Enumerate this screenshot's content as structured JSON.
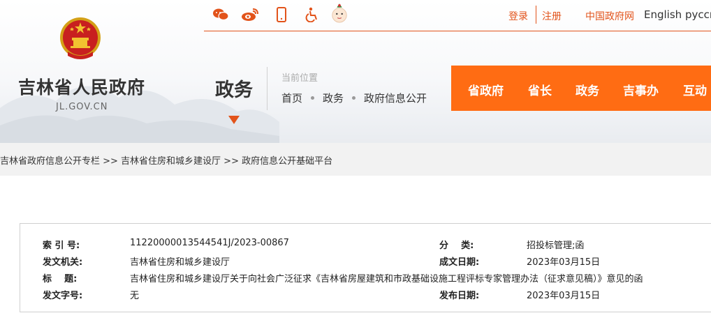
{
  "topbar": {
    "icons": [
      "wechat-icon",
      "weibo-icon",
      "mobile-icon",
      "accessibility-icon",
      "mascot-icon"
    ],
    "login": "登录",
    "register": "注册",
    "gov_link": "中国政府网",
    "english": "English",
    "russian": "русск"
  },
  "site": {
    "name": "吉林省人民政府",
    "domain": "JL.GOV.CN"
  },
  "section": {
    "title": "政务"
  },
  "location": {
    "label": "当前位置",
    "crumbs": [
      "首页",
      "政务",
      "政府信息公开"
    ]
  },
  "nav": {
    "items": [
      "省政府",
      "省长",
      "政务",
      "吉事办",
      "互动"
    ]
  },
  "path": {
    "text": "吉林省政府信息公开专栏 >> 吉林省住房和城乡建设厅 >> 政府信息公开基础平台"
  },
  "info": {
    "index_label": "索 引 号:",
    "index_value": "11220000013544541J/2023-00867",
    "category_label": "分    类:",
    "category_value": "招投标管理;函",
    "issuer_label": "发文机关:",
    "issuer_value": "吉林省住房和城乡建设厅",
    "created_label": "成文日期:",
    "created_value": "2023年03月15日",
    "title_label": "标    题:",
    "title_value": "吉林省住房和城乡建设厅关于向社会广泛征求《吉林省房屋建筑和市政基础设施工程评标专家管理办法（征求意见稿）》意见的函",
    "docno_label": "发文字号:",
    "docno_value": "无",
    "published_label": "发布日期:",
    "published_value": "2023年03月15日"
  },
  "colors": {
    "accent": "#e2531a",
    "nav_bg": "#ff6c13"
  }
}
